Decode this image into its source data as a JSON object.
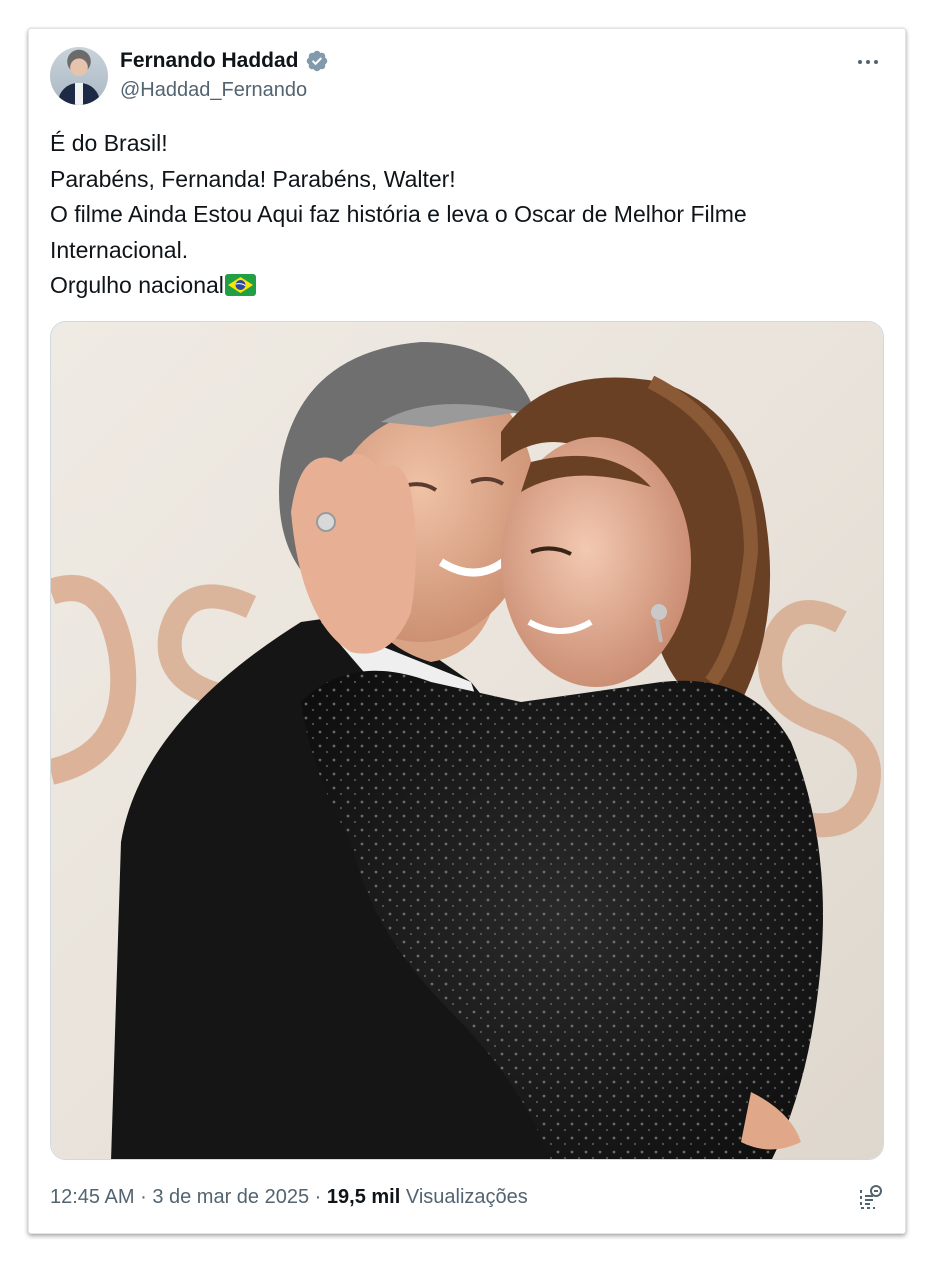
{
  "author": {
    "name": "Fernando Haddad",
    "handle": "@Haddad_Fernando",
    "verified": true
  },
  "tweet": {
    "lines": [
      "É do Brasil!",
      "Parabéns, Fernanda! Parabéns, Walter!",
      "O filme Ainda Estou Aqui faz história e leva o Oscar de Melhor Filme",
      "Internacional.",
      "Orgulho nacional"
    ],
    "flag_emoji": "🇧🇷"
  },
  "media": {
    "backdrop_text": "OSCARS"
  },
  "footer": {
    "time": "12:45 AM",
    "separator": "·",
    "date": "3 de mar de 2025",
    "views_count": "19,5 mil",
    "views_label": "Visualizações"
  },
  "colors": {
    "text_primary": "#0f1419",
    "text_secondary": "#536471",
    "verified_blue": "#1d9bf0",
    "verified_gray": "#829aab",
    "border": "#cfd9de"
  },
  "icons": {
    "verified": "verified-badge-icon",
    "more": "more-icon",
    "flag": "brazil-flag-icon",
    "action": "bookmark-icon"
  }
}
